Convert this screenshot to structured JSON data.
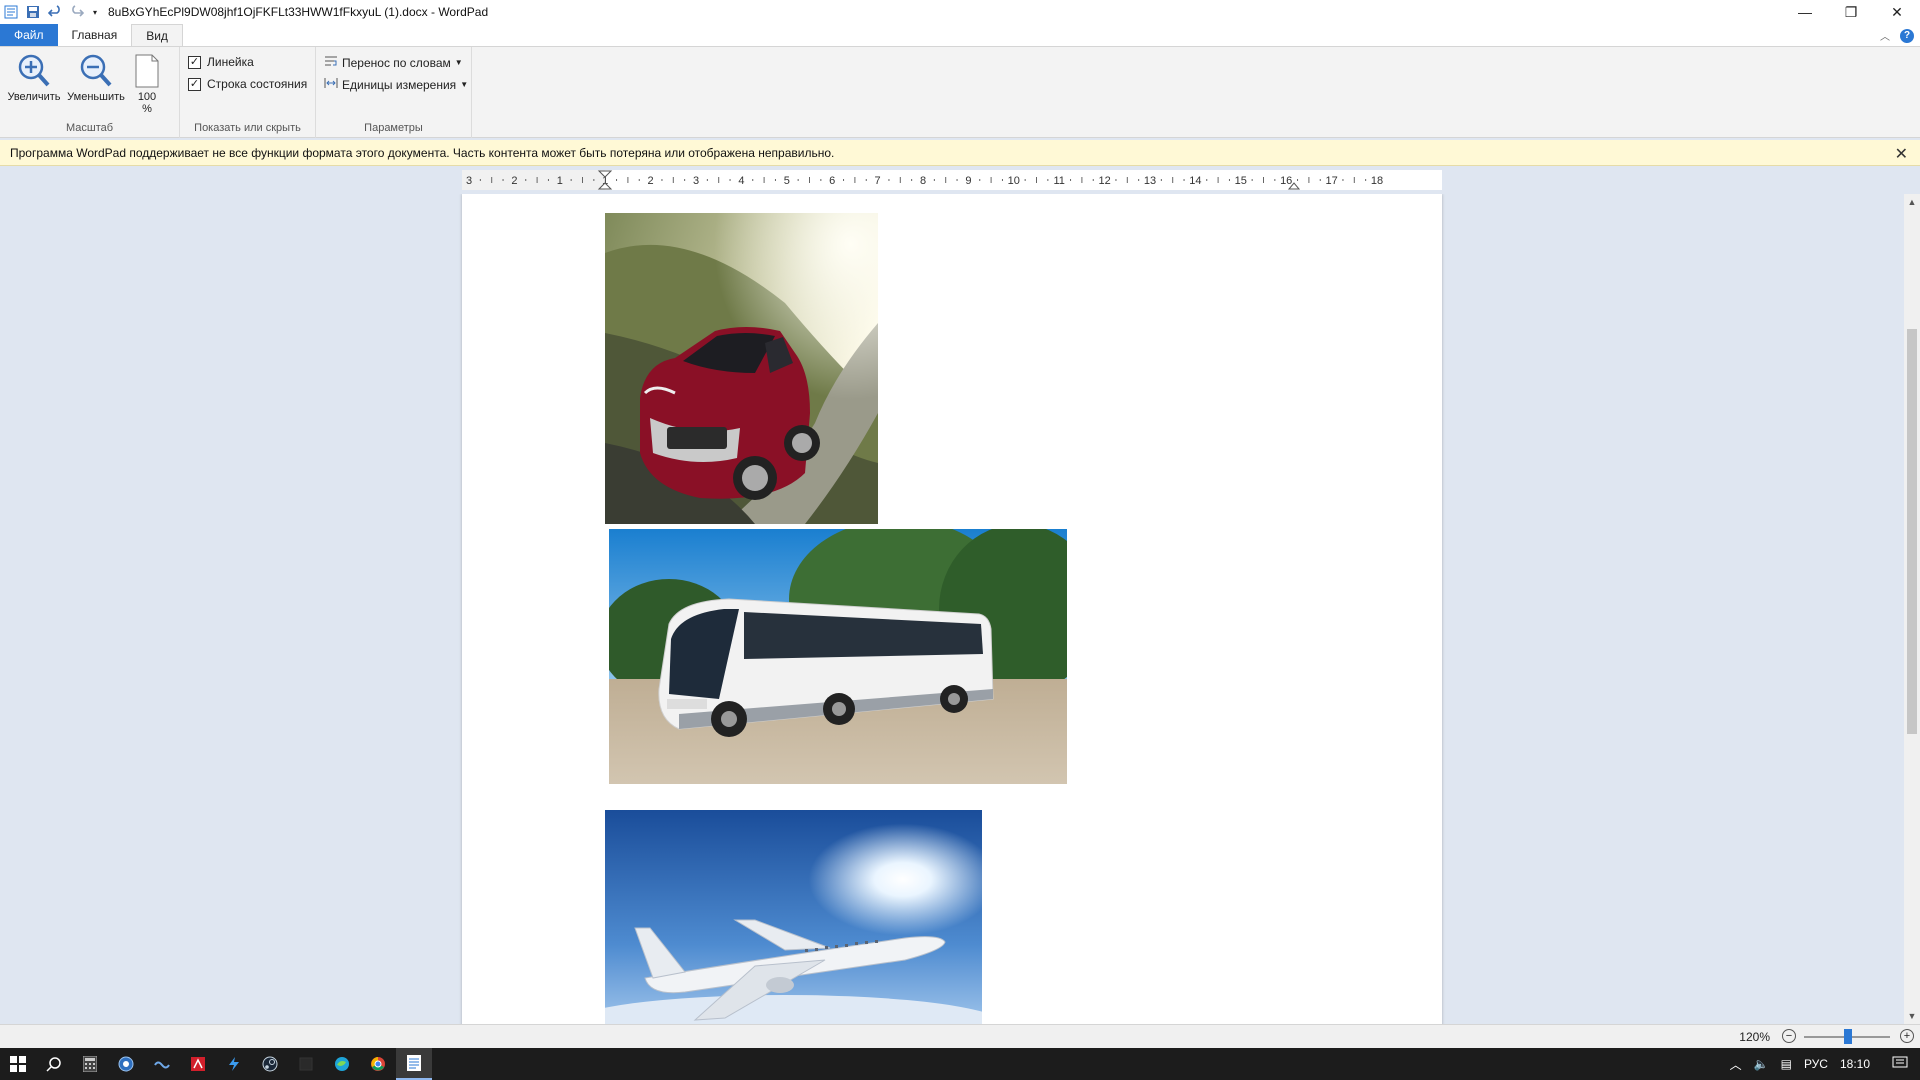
{
  "window": {
    "title": "8uBxGYhEcPl9DW08jhf1OjFKFLt33HWW1fFkxyuL (1).docx - WordPad",
    "minimize_glyph": "—",
    "restore_glyph": "❐",
    "close_glyph": "✕"
  },
  "tabs": {
    "file": "Файл",
    "home": "Главная",
    "view": "Вид"
  },
  "ribbon": {
    "zoom_group": {
      "label": "Масштаб",
      "zoom_in": "Увеличить",
      "zoom_out": "Уменьшить",
      "hundred": "100",
      "percent": "%"
    },
    "show_group": {
      "label": "Показать или скрыть",
      "ruler": "Линейка",
      "ruler_checked": true,
      "statusbar": "Строка состояния",
      "statusbar_checked": true
    },
    "params_group": {
      "label": "Параметры",
      "wordwrap": "Перенос по словам",
      "units": "Единицы измерения"
    }
  },
  "warning": {
    "text": "Программа WordPad поддерживает не все функции формата этого документа. Часть контента может быть потеряна или отображена неправильно.",
    "close": "✕"
  },
  "ruler": {
    "labels": [
      "3",
      "2",
      "1",
      "1",
      "2",
      "3",
      "4",
      "5",
      "6",
      "7",
      "8",
      "9",
      "10",
      "11",
      "12",
      "13",
      "14",
      "15",
      "16",
      "17",
      "18"
    ]
  },
  "document": {
    "images": [
      {
        "name": "red-car-image",
        "subject": "red sedan on a country road"
      },
      {
        "name": "bus-image",
        "subject": "white coach bus"
      },
      {
        "name": "airplane-image",
        "subject": "airliner in sunny sky"
      }
    ]
  },
  "statusbar": {
    "zoom": "120%",
    "minus": "−",
    "plus": "+",
    "zoom_level_percent": 120
  },
  "taskbar": {
    "lang": "РУС",
    "time": "18:10"
  },
  "colors": {
    "accent": "#2b78d4",
    "warning_bg": "#fff9d6",
    "doc_bg": "#dfe6f1"
  }
}
